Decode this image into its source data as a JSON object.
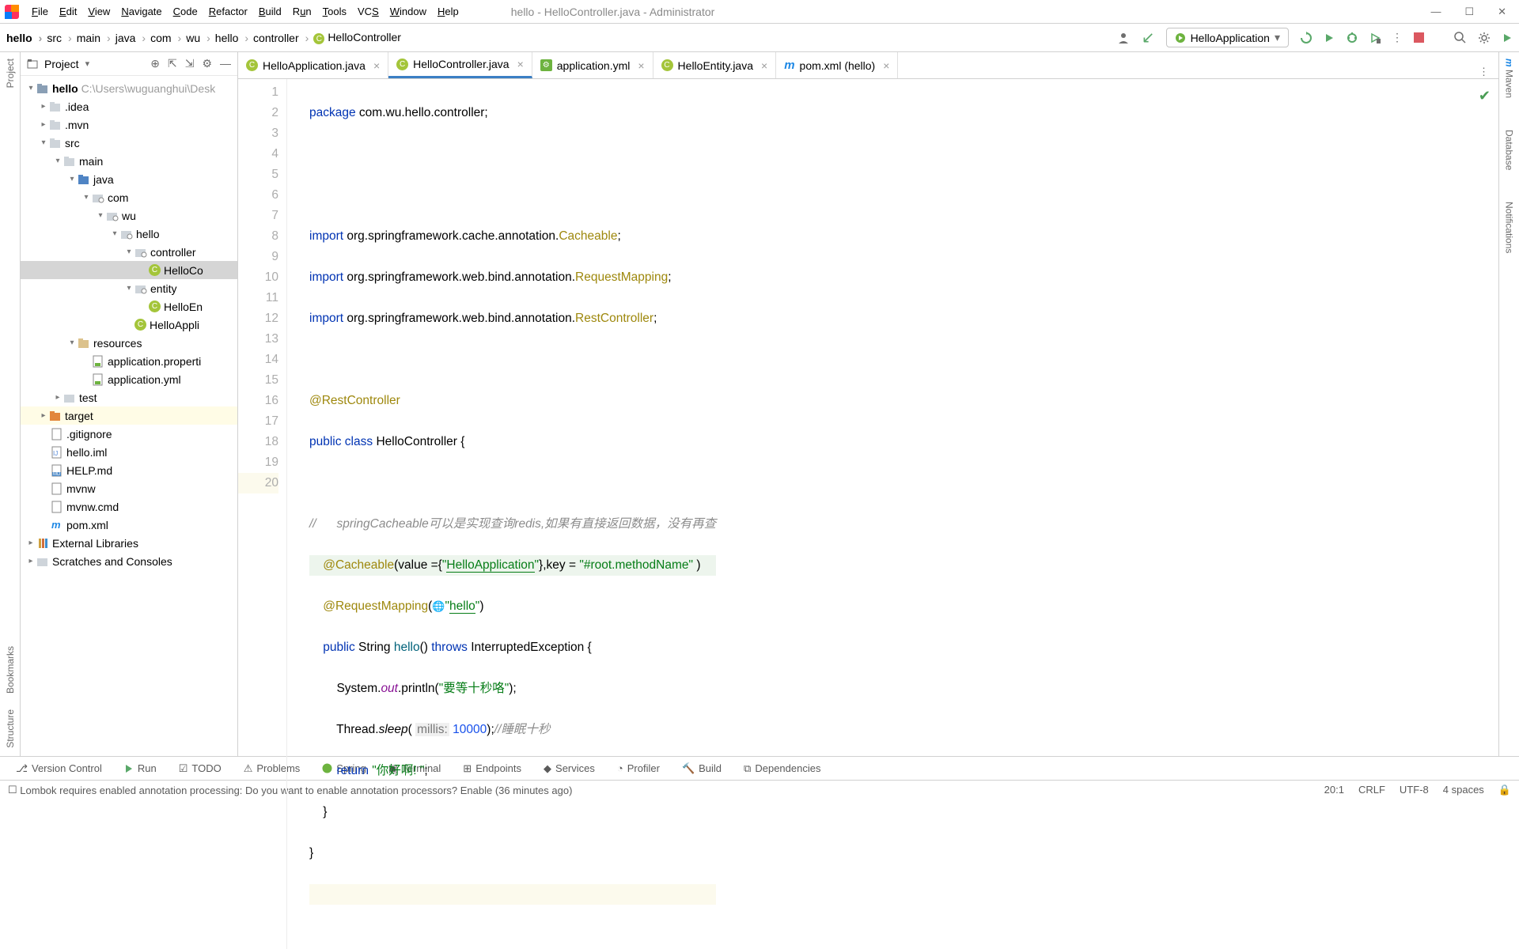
{
  "title": "hello - HelloController.java - Administrator",
  "menus": [
    "File",
    "Edit",
    "View",
    "Navigate",
    "Code",
    "Refactor",
    "Build",
    "Run",
    "Tools",
    "VCS",
    "Window",
    "Help"
  ],
  "breadcrumbs": [
    "hello",
    "src",
    "main",
    "java",
    "com",
    "wu",
    "hello",
    "controller",
    "HelloController"
  ],
  "run_config": "HelloApplication",
  "project_label": "Project",
  "tree_root": "hello",
  "tree_root_path": "C:\\Users\\wuguanghui\\Desk",
  "tree": {
    "idea": ".idea",
    "mvn": ".mvn",
    "src": "src",
    "main": "main",
    "java": "java",
    "com": "com",
    "wu": "wu",
    "hello": "hello",
    "controller": "controller",
    "hellocontroller": "HelloCo",
    "entity": "entity",
    "helloentity": "HelloEn",
    "helloapp": "HelloAppli",
    "resources": "resources",
    "app_prop": "application.properti",
    "app_yml": "application.yml",
    "test": "test",
    "target": "target",
    "gitignore": ".gitignore",
    "iml": "hello.iml",
    "help": "HELP.md",
    "mvnw": "mvnw",
    "mvnwcmd": "mvnw.cmd",
    "pom": "pom.xml",
    "ext": "External Libraries",
    "scratch": "Scratches and Consoles"
  },
  "tabs": [
    {
      "label": "HelloApplication.java",
      "ic": "c"
    },
    {
      "label": "HelloController.java",
      "ic": "c"
    },
    {
      "label": "application.yml",
      "ic": "y"
    },
    {
      "label": "HelloEntity.java",
      "ic": "c"
    },
    {
      "label": "pom.xml (hello)",
      "ic": "m"
    }
  ],
  "code": {
    "l1a": "package",
    "l1b": " com.wu.hello.controller;",
    "l4a": "import",
    "l4b": " org.springframework.cache.annotation.",
    "l4c": "Cacheable",
    "l4d": ";",
    "l5a": "import",
    "l5b": " org.springframework.web.bind.annotation.",
    "l5c": "RequestMapping",
    "l5d": ";",
    "l6a": "import",
    "l6b": " org.springframework.web.bind.annotation.",
    "l6c": "RestController",
    "l6d": ";",
    "l8a": "@RestController",
    "l9a": "public class ",
    "l9b": "HelloController",
    " l9c": " {",
    "l11a": "//      springCacheable",
    "l11b": "可以是实现查询redis,如果有直接返回数据，没有再查",
    "l12a": "@Cacheable",
    "l12b": "(value ={",
    "l12c": "\"",
    "l12d": "HelloApplication",
    "l12e": "\"",
    "l12f": "},key = ",
    "l12g": "\"#root.methodName\"",
    "l12h": " )",
    "l13a": "@RequestMapping",
    "l13b": "(",
    "l13c": "\"",
    "l13d": "hello",
    "l13e": "\"",
    "l13f": ")",
    "l14a": "public ",
    "l14b": "String ",
    "l14c": "hello",
    "l14d": "() ",
    "l14e": "throws ",
    "l14f": "InterruptedException {",
    "l15a": "System.",
    "l15b": "out",
    "l15c": ".println(",
    "l15d": "\"要等十秒咯\"",
    "l15e": ");",
    "l16a": "Thread.",
    "l16b": "sleep",
    "l16c": "( ",
    "l16d": "millis:",
    "l16e": " 10000",
    "l16f": ");",
    "l16g": "//睡眠十秒",
    "l17a": "return ",
    "l17b": "\"你好啊! \"",
    "l17c": ";",
    "l18": "}",
    "l19": "}"
  },
  "lines": [
    "1",
    "2",
    "3",
    "4",
    "5",
    "6",
    "7",
    "8",
    "9",
    "10",
    "11",
    "12",
    "13",
    "14",
    "15",
    "16",
    "17",
    "18",
    "19",
    "20"
  ],
  "bottom": [
    "Version Control",
    "Run",
    "TODO",
    "Problems",
    "Spring",
    "Terminal",
    "Endpoints",
    "Services",
    "Profiler",
    "Build",
    "Dependencies"
  ],
  "status_msg": "Lombok requires enabled annotation processing: Do you want to enable annotation processors? Enable (36 minutes ago)",
  "status_right": [
    "20:1",
    "CRLF",
    "UTF-8",
    "4 spaces"
  ],
  "left_tabs": [
    "Project",
    "Bookmarks",
    "Structure"
  ],
  "right_tabs": [
    "Maven",
    "Database",
    "Notifications"
  ]
}
